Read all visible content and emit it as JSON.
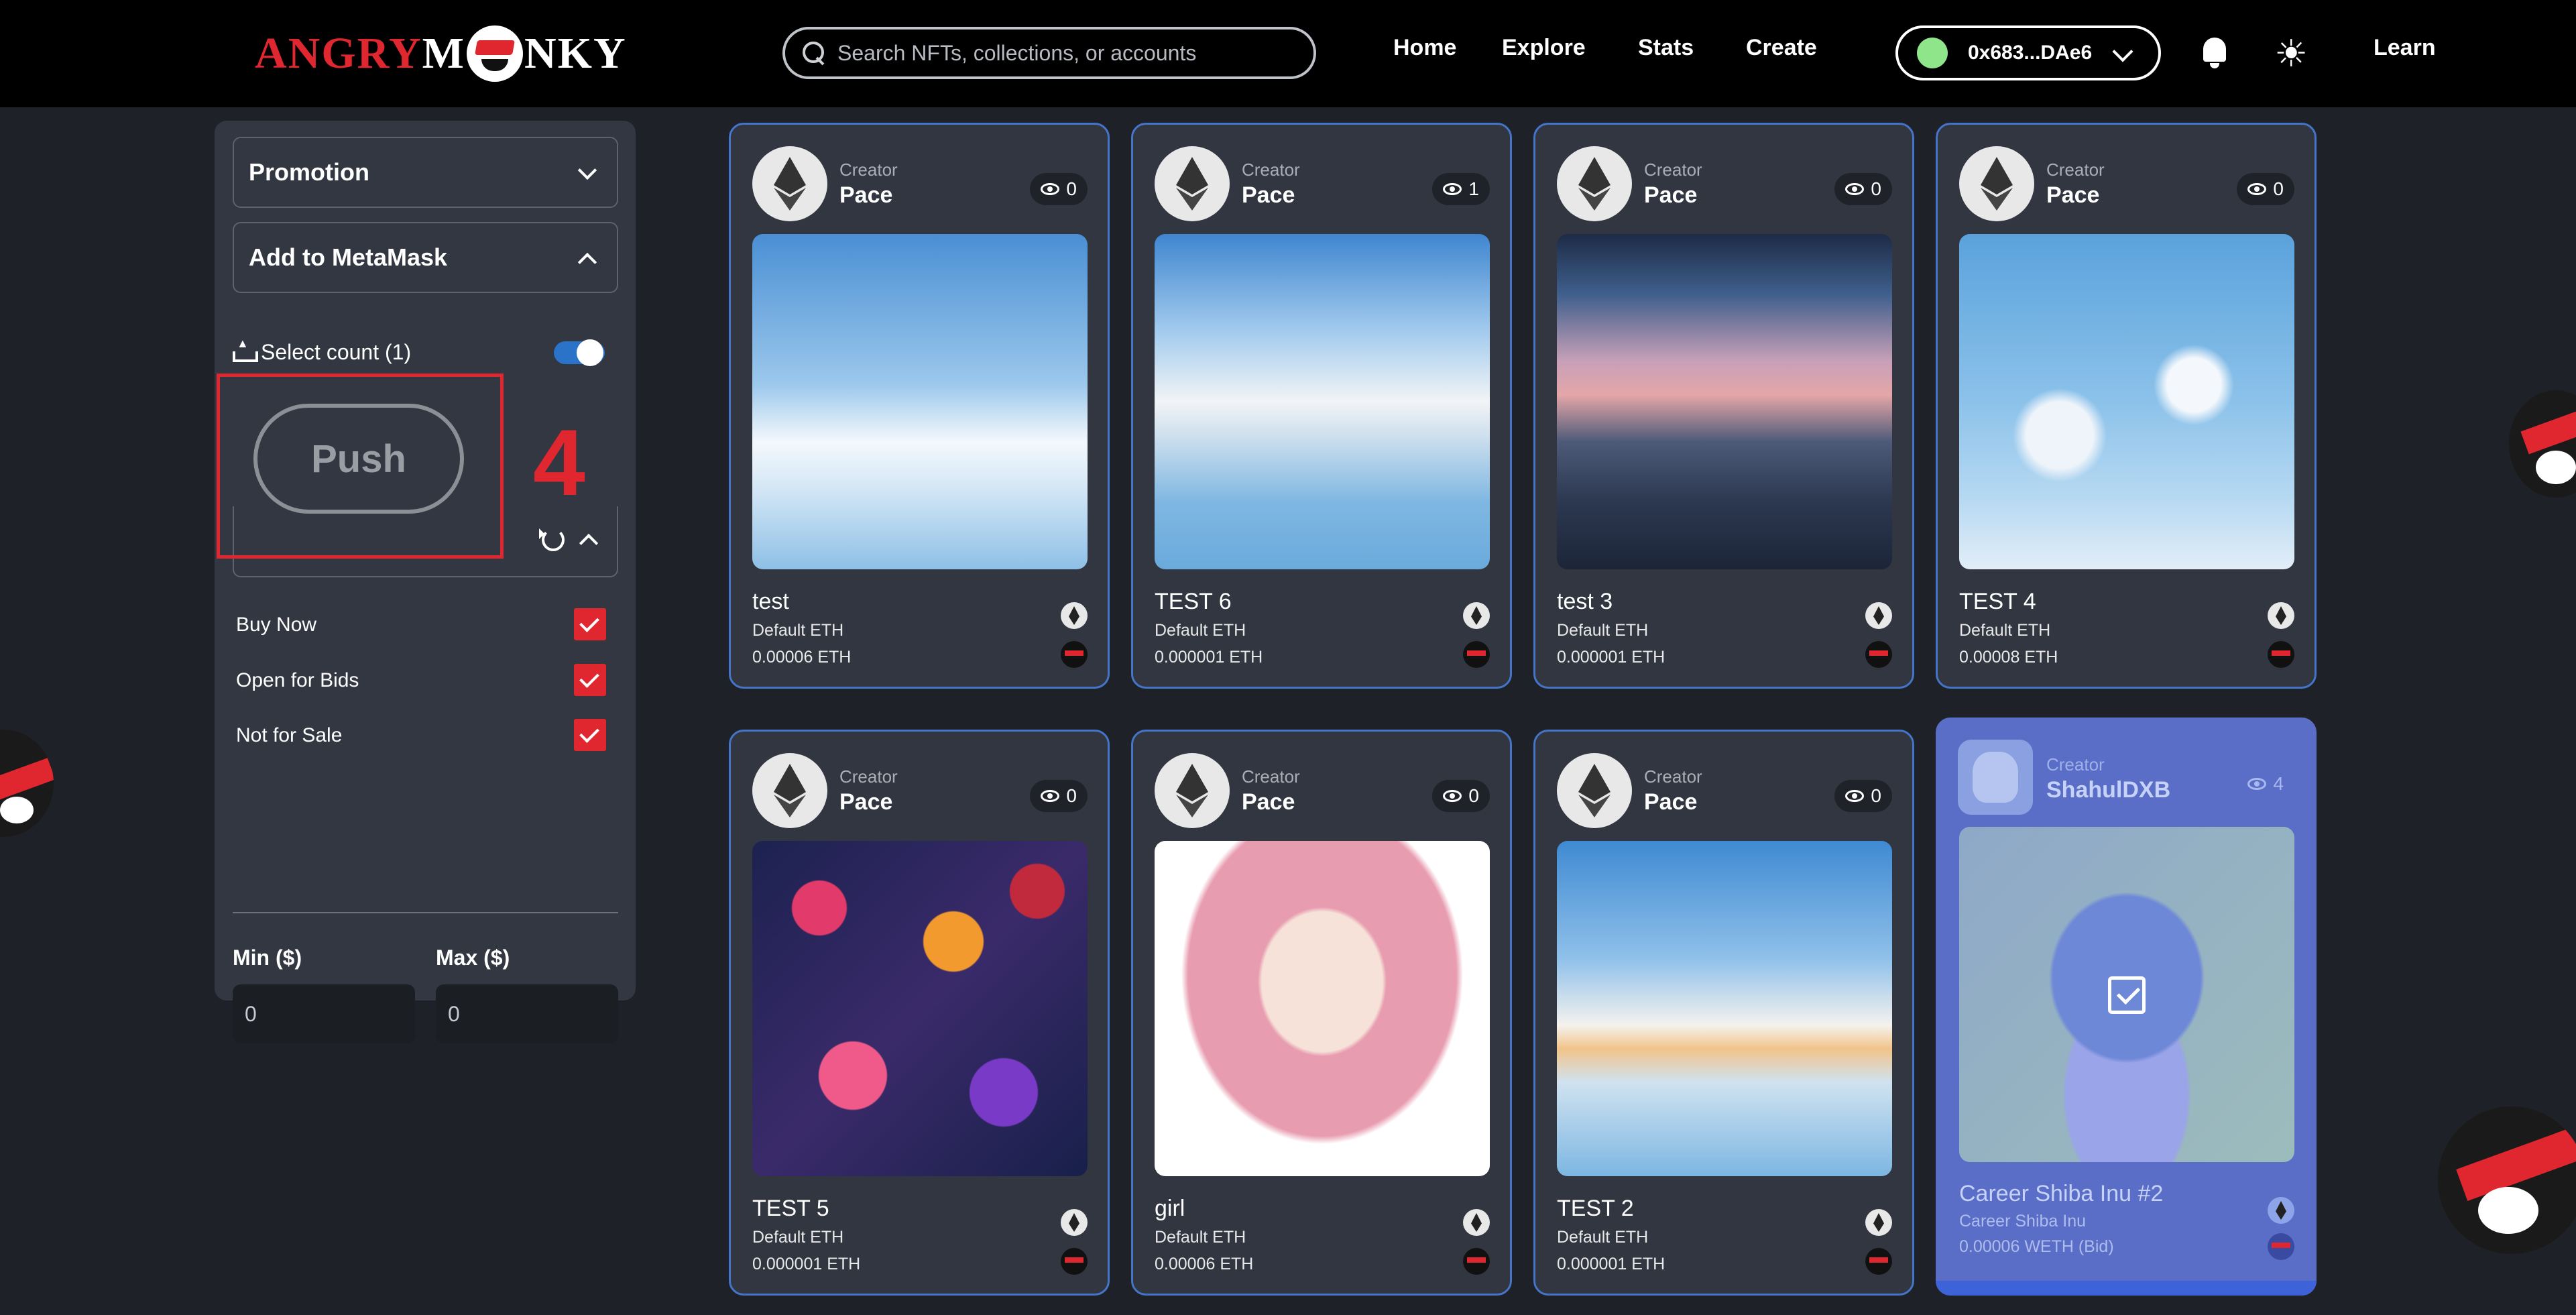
{
  "header": {
    "logo_text_1": "ANGRY",
    "logo_text_2": "NKY",
    "logo_prefix_m": "M",
    "search_placeholder": "Search NFTs, collections, or accounts",
    "nav": [
      "Home",
      "Explore",
      "Stats",
      "Create"
    ],
    "wallet_address": "0x683...DAe6",
    "learn_label": "Learn",
    "sun_icon": "☀"
  },
  "sidebar": {
    "promotion_label": "Promotion",
    "metamask_label": "Add to MetaMask",
    "select_count_label": "Select count (1)",
    "push_label": "Push",
    "step_badge": "4",
    "filters": [
      {
        "label": "Buy Now",
        "checked": true
      },
      {
        "label": "Open for Bids",
        "checked": true
      },
      {
        "label": "Not for Sale",
        "checked": true
      }
    ],
    "min_label": "Min ($)",
    "max_label": "Max ($)",
    "min_value": "0",
    "max_value": "0"
  },
  "creator_label": "Creator",
  "cards": [
    {
      "creator": "Pace",
      "views": "0",
      "title": "test",
      "sub": "Default ETH",
      "price": "0.00006  ETH"
    },
    {
      "creator": "Pace",
      "views": "1",
      "title": "TEST 6",
      "sub": "Default ETH",
      "price": "0.000001  ETH"
    },
    {
      "creator": "Pace",
      "views": "0",
      "title": "test 3",
      "sub": "Default ETH",
      "price": "0.000001  ETH"
    },
    {
      "creator": "Pace",
      "views": "0",
      "title": "TEST 4",
      "sub": "Default ETH",
      "price": "0.00008  ETH"
    },
    {
      "creator": "Pace",
      "views": "0",
      "title": "TEST 5",
      "sub": "Default ETH",
      "price": "0.000001  ETH"
    },
    {
      "creator": "Pace",
      "views": "0",
      "title": "girl",
      "sub": "Default ETH",
      "price": "0.00006  ETH"
    },
    {
      "creator": "Pace",
      "views": "0",
      "title": "TEST 2",
      "sub": "Default ETH",
      "price": "0.000001  ETH"
    },
    {
      "creator": "ShahulDXB",
      "views": "4",
      "title": "Career Shiba Inu #2",
      "sub": "Career Shiba Inu",
      "price": "0.00006  WETH (Bid)"
    }
  ],
  "colors": {
    "accent_red": "#e0262f",
    "card_border": "#4475c9",
    "featured_card": "#5a6ec8"
  }
}
